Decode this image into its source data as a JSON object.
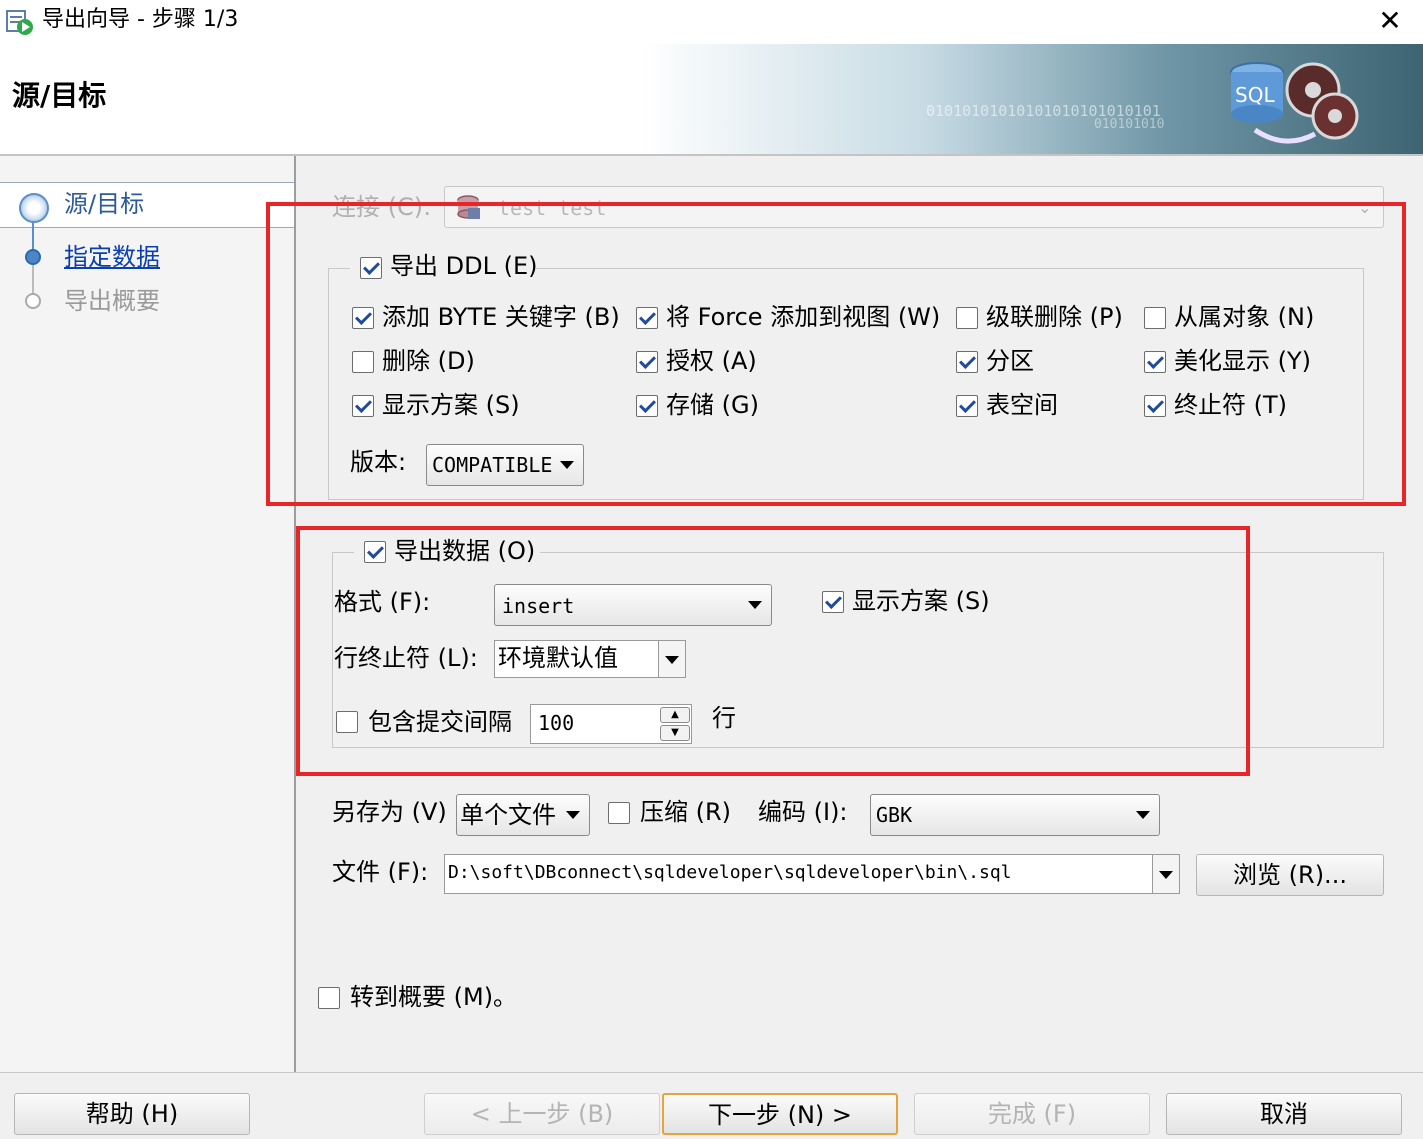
{
  "window": {
    "title": "导出向导 - 步骤 1/3",
    "close_glyph": "✕"
  },
  "header": {
    "title": "源/目标",
    "binary_1": "01010101010101010101010101",
    "binary_2": "010101010",
    "graphic_text": "SQL"
  },
  "nav": {
    "steps": [
      {
        "label": "源/目标"
      },
      {
        "label": "指定数据"
      },
      {
        "label": "导出概要"
      }
    ]
  },
  "connection": {
    "label": "连接 (C):",
    "value": "test  test"
  },
  "ddl": {
    "enabled": true,
    "legend": "导出 DDL (E)",
    "options": [
      {
        "label": "添加 BYTE 关键字 (B)",
        "checked": true
      },
      {
        "label": "将 Force 添加到视图 (W)",
        "checked": true
      },
      {
        "label": "级联删除 (P)",
        "checked": false
      },
      {
        "label": "从属对象 (N)",
        "checked": false
      },
      {
        "label": "删除 (D)",
        "checked": false
      },
      {
        "label": "授权 (A)",
        "checked": true
      },
      {
        "label": "分区",
        "checked": true
      },
      {
        "label": "美化显示 (Y)",
        "checked": true
      },
      {
        "label": "显示方案 (S)",
        "checked": true
      },
      {
        "label": "存储 (G)",
        "checked": true
      },
      {
        "label": "表空间",
        "checked": true
      },
      {
        "label": "终止符 (T)",
        "checked": true
      }
    ],
    "version_label": "版本:",
    "version_value": "COMPATIBLE"
  },
  "data_export": {
    "enabled": true,
    "legend": "导出数据 (O)",
    "format_label": "格式 (F):",
    "format_value": "insert",
    "show_schema_label": "显示方案 (S)",
    "show_schema_checked": true,
    "line_terminator_label": "行终止符 (L):",
    "line_terminator_value": "环境默认值",
    "commit_interval_label": "包含提交间隔",
    "commit_interval_checked": false,
    "commit_interval_value": "100",
    "commit_interval_unit": "行"
  },
  "save": {
    "save_as_label": "另存为 (V)",
    "save_as_value": "单个文件",
    "compress_label": "压缩 (R)",
    "compress_checked": false,
    "encoding_label": "编码 (I):",
    "encoding_value": "GBK",
    "file_label": "文件 (F):",
    "file_value": "D:\\soft\\DBconnect\\sqldeveloper\\sqldeveloper\\bin\\.sql",
    "browse_label": "浏览 (R)..."
  },
  "goto_summary": {
    "label": "转到概要 (M)。",
    "checked": false
  },
  "buttons": {
    "help": "帮助 (H)",
    "back": "< 上一步 (B)",
    "next": "下一步 (N) >",
    "finish": "完成 (F)",
    "cancel": "取消"
  },
  "colors": {
    "highlight": "#e8262a",
    "link": "#0b3fb0",
    "check": "#1f4d9a"
  }
}
